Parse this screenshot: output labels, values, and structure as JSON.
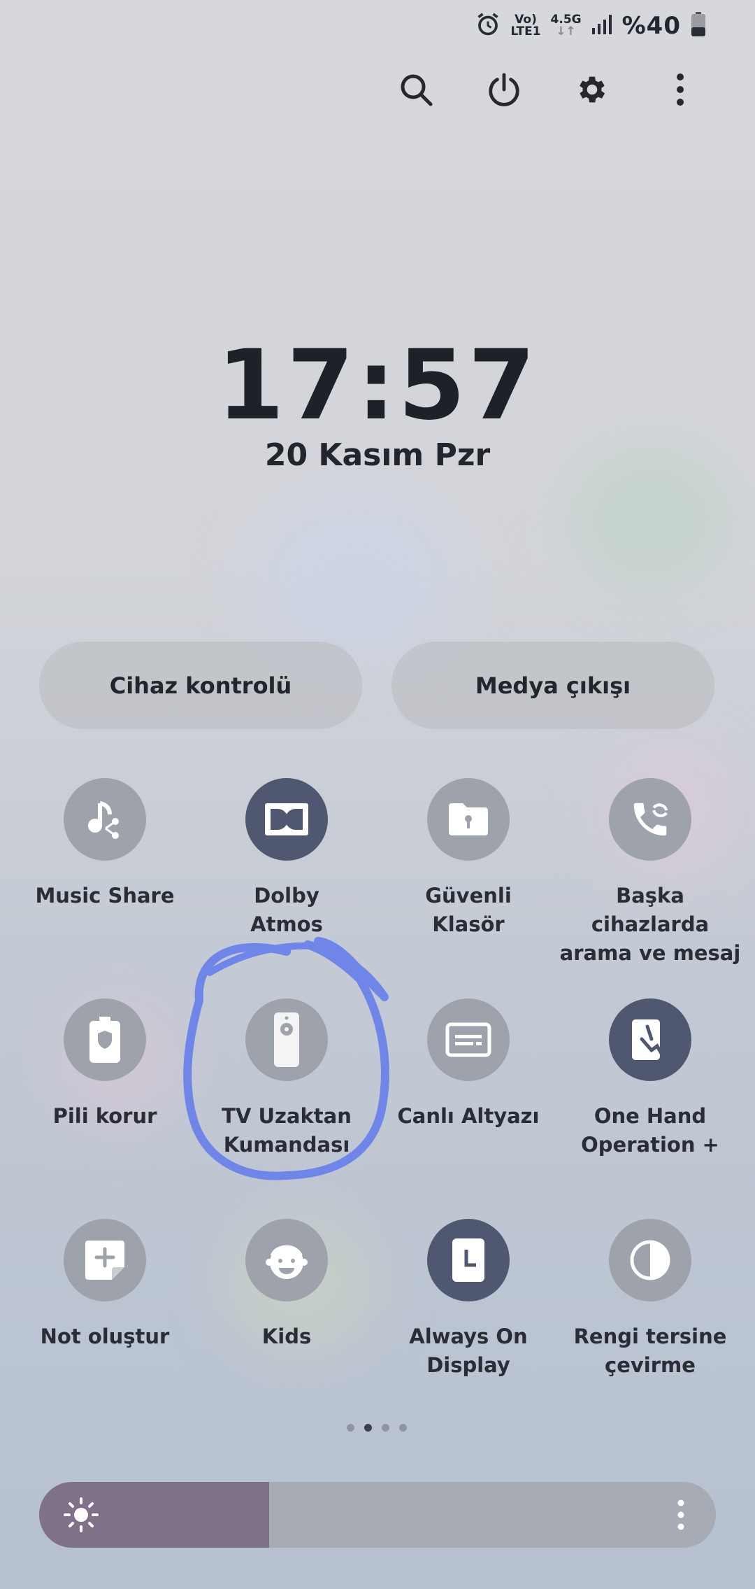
{
  "status_bar": {
    "volte": "Vo)",
    "lte": "LTE1",
    "network": "4.5G",
    "battery": "%40",
    "icons": [
      "alarm-icon",
      "data-arrows-icon",
      "signal-icon",
      "battery-icon"
    ]
  },
  "top_actions": [
    {
      "name": "search-button",
      "icon": "search-icon"
    },
    {
      "name": "power-button",
      "icon": "power-icon"
    },
    {
      "name": "settings-button",
      "icon": "gear-icon"
    },
    {
      "name": "more-options-button",
      "icon": "kebab-icon"
    }
  ],
  "clock": {
    "time": "17:57",
    "date": "20 Kasım Pzr"
  },
  "pills": {
    "device_control": "Cihaz kontrolü",
    "media_output": "Medya çıkışı"
  },
  "tiles": [
    {
      "label": "Music Share",
      "icon": "music-share-icon",
      "active": false
    },
    {
      "label": "Dolby\nAtmos",
      "icon": "dolby-icon",
      "active": true
    },
    {
      "label": "Güvenli\nKlasör",
      "icon": "secure-folder-icon",
      "active": false
    },
    {
      "label": "Başka cihazlarda\narama ve mesaj",
      "icon": "call-sync-icon",
      "active": false
    },
    {
      "label": "Pili korur",
      "icon": "battery-shield-icon",
      "active": false
    },
    {
      "label": "TV Uzaktan\nKumandası",
      "icon": "remote-icon",
      "active": false
    },
    {
      "label": "Canlı Altyazı",
      "icon": "caption-icon",
      "active": false
    },
    {
      "label": "One Hand\nOperation +",
      "icon": "one-hand-icon",
      "active": true
    },
    {
      "label": "Not oluştur",
      "icon": "note-add-icon",
      "active": false
    },
    {
      "label": "Kids",
      "icon": "kids-icon",
      "active": false
    },
    {
      "label": "Always On\nDisplay",
      "icon": "clock-icon",
      "active": true
    },
    {
      "label": "Rengi tersine\nçevirme",
      "icon": "invert-icon",
      "active": false
    }
  ],
  "pager": {
    "pages": 4,
    "current": 2
  },
  "brightness": {
    "level": 0.34,
    "icon": "sun-icon",
    "more_icon": "kebab-icon"
  },
  "colors": {
    "tile_off": "#9ea2ab",
    "tile_on": "#4f5870",
    "annotation_stroke": "#6f86e8",
    "brightness_fill": "#7f7187"
  }
}
